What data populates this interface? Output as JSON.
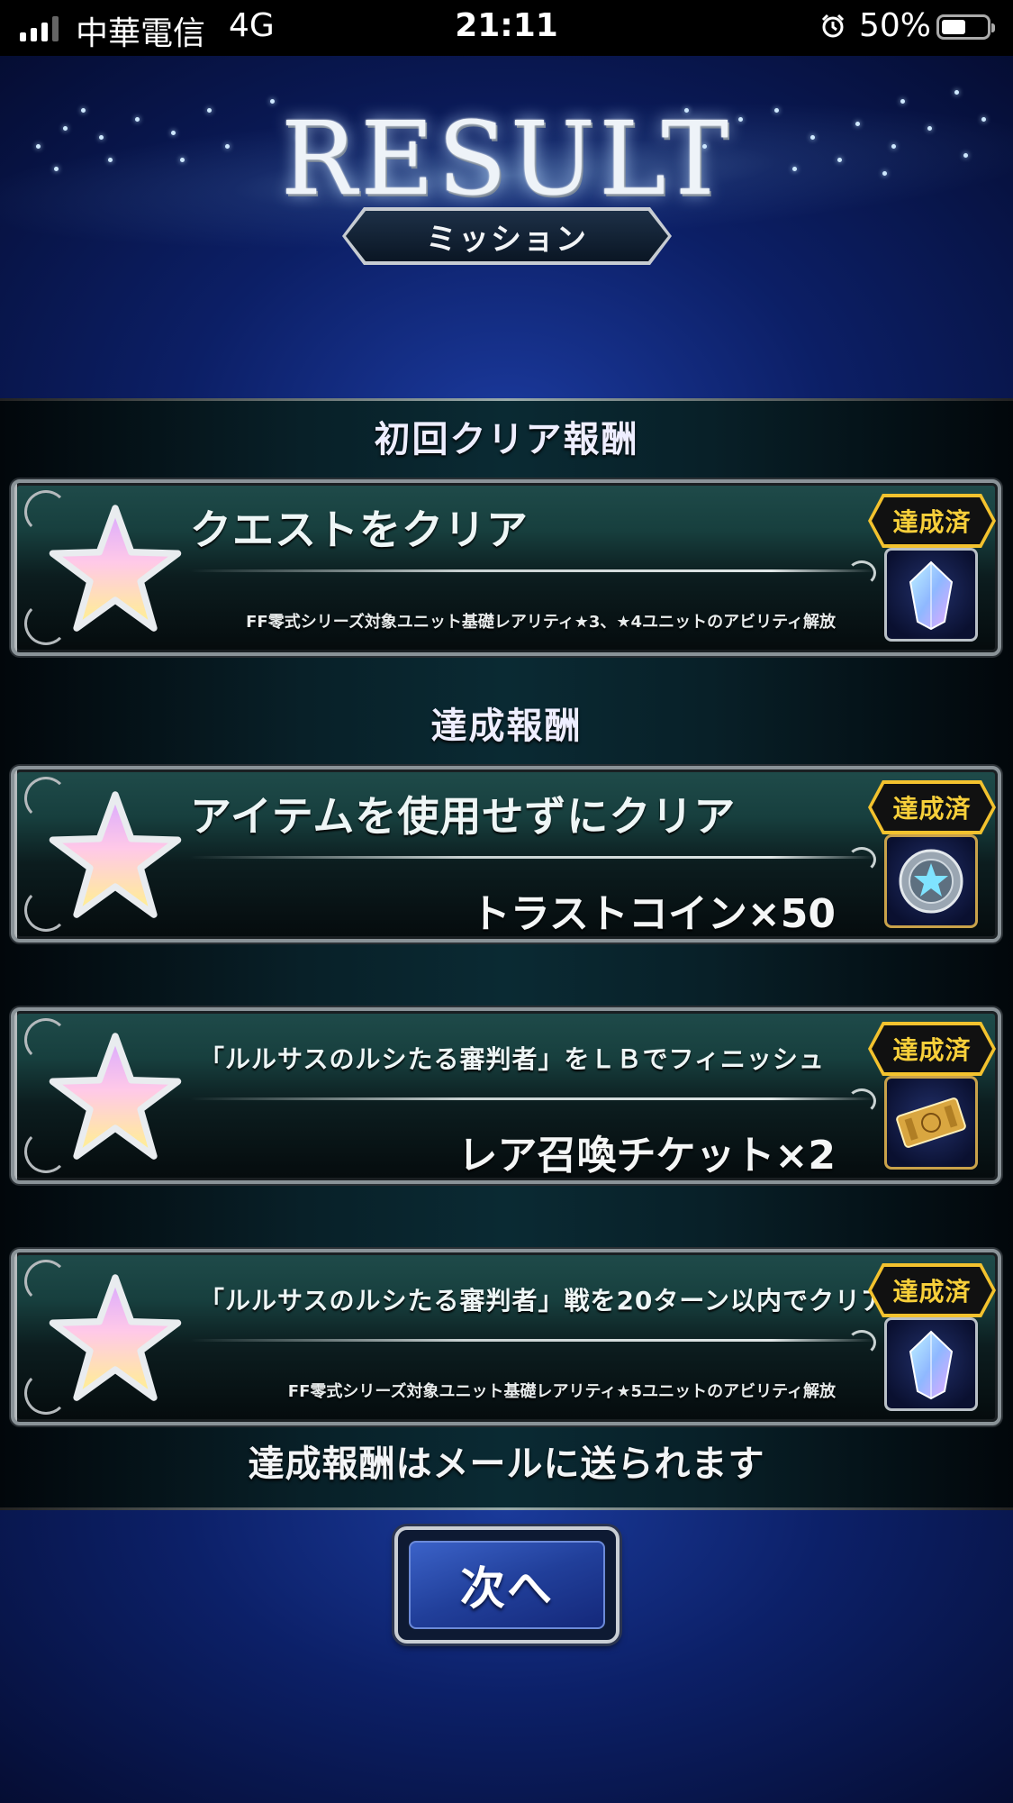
{
  "status_bar": {
    "carrier": "中華電信",
    "network": "4G",
    "time": "21:11",
    "battery_percent": "50%",
    "signal_bars": 4,
    "signal_bars_active": 3
  },
  "header": {
    "title": "RESULT",
    "subtitle": "ミッション"
  },
  "sections": {
    "first_clear_title": "初回クリア報酬",
    "achievement_title": "達成報酬"
  },
  "missions": [
    {
      "title": "クエストをクリア",
      "reward": "FF零式シリーズ対象ユニット基礎レアリティ★3、★4ユニットのアビリティ解放",
      "badge": "達成済",
      "reward_icon": "crystal-icon"
    },
    {
      "title": "アイテムを使用せずにクリア",
      "reward": "トラストコイン×50",
      "badge": "達成済",
      "reward_icon": "trust-coin-icon"
    },
    {
      "title": "「ルルサスのルシたる審判者」をＬＢでフィニッシュ",
      "reward": "レア召喚チケット×2",
      "badge": "達成済",
      "reward_icon": "summon-ticket-icon"
    },
    {
      "title": "「ルルサスのルシたる審判者」戦を20ターン以内でクリア",
      "reward": "FF零式シリーズ対象ユニット基礎レアリティ★5ユニットのアビリティ解放",
      "badge": "達成済",
      "reward_icon": "crystal-icon"
    }
  ],
  "footer": {
    "note": "達成報酬はメールに送られます",
    "next_button": "次へ"
  },
  "colors": {
    "badge_gold": "#f3c22e",
    "panel_teal": "#1f4b4a",
    "button_blue": "#2b4db0",
    "background_navy": "#0c1f66"
  }
}
